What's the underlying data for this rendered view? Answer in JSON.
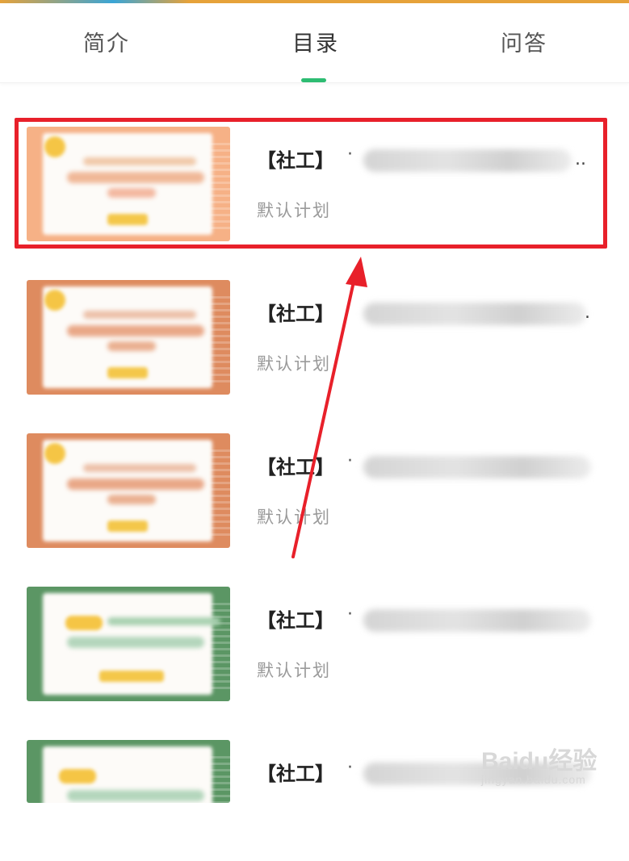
{
  "tabs": [
    {
      "label": "简介",
      "active": false
    },
    {
      "label": "目录",
      "active": true
    },
    {
      "label": "问答",
      "active": false
    }
  ],
  "accent_color": "#2dbc72",
  "highlight_color": "#e8202a",
  "catalog": [
    {
      "title": "【社工】",
      "separator": "·",
      "ellipsis": "..",
      "plan": "默认计划",
      "thumb_theme": "orange-light",
      "highlighted": true
    },
    {
      "title": "【社工】",
      "separator": "·",
      "ellipsis": ".",
      "plan": "默认计划",
      "thumb_theme": "orange",
      "highlighted": false
    },
    {
      "title": "【社工】",
      "separator": "·",
      "ellipsis": "",
      "plan": "默认计划",
      "thumb_theme": "orange",
      "highlighted": false
    },
    {
      "title": "【社工】",
      "separator": "·",
      "ellipsis": "",
      "plan": "默认计划",
      "thumb_theme": "green",
      "highlighted": false
    },
    {
      "title": "【社工】",
      "separator": "·",
      "ellipsis": "",
      "plan": "",
      "thumb_theme": "green",
      "highlighted": false
    }
  ],
  "watermark": {
    "brand": "Baidu经验",
    "url": "jingyan.baidu.com"
  }
}
